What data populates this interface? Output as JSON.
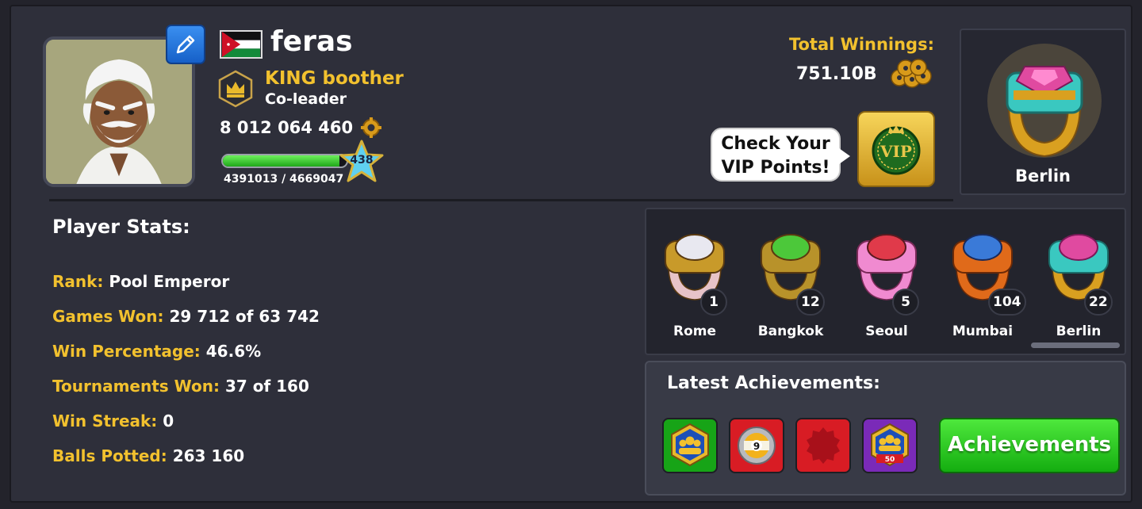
{
  "profile": {
    "name": "feras",
    "club_name": "KING boother",
    "club_role": "Co-leader",
    "coins": "8 012 064 460",
    "xp_text": "4391013 / 4669047",
    "xp_fraction": 0.94,
    "level": "438"
  },
  "winnings": {
    "label": "Total Winnings:",
    "value": "751.10B"
  },
  "vip": {
    "bubble_text": "Check Your VIP Points!",
    "badge_text": "VIP"
  },
  "league": {
    "name": "Berlin"
  },
  "stats": {
    "title": "Player Stats:",
    "rows": [
      {
        "label": "Rank:",
        "value": "Pool Emperor"
      },
      {
        "label": "Games Won:",
        "value": "29 712 of 63 742"
      },
      {
        "label": "Win Percentage:",
        "value": "46.6%"
      },
      {
        "label": "Tournaments Won:",
        "value": "37 of 160"
      },
      {
        "label": "Win Streak:",
        "value": "0"
      },
      {
        "label": "Balls Potted:",
        "value": "263 160"
      }
    ]
  },
  "rings": [
    {
      "name": "Rome",
      "count": "1",
      "stone": "#e8e8f0",
      "band": "#e7c3c8"
    },
    {
      "name": "Bangkok",
      "count": "12",
      "stone": "#4cc83a",
      "band": "#b8922a"
    },
    {
      "name": "Seoul",
      "count": "5",
      "stone": "#e03a4a",
      "band": "#f08ad0"
    },
    {
      "name": "Mumbai",
      "count": "104",
      "stone": "#3a7ad8",
      "band": "#e06a1a"
    },
    {
      "name": "Berlin",
      "count": "22",
      "stone": "#e04aa0",
      "band": "#3ac8c0"
    }
  ],
  "achievements": {
    "title": "Latest Achievements:",
    "button_label": "Achievements",
    "icons": [
      {
        "name": "club-achievement-icon",
        "color": "#17a417"
      },
      {
        "name": "nine-ball-achievement-icon",
        "color": "#d81c24"
      },
      {
        "name": "red-seal-achievement-icon",
        "color": "#d81c24"
      },
      {
        "name": "club-50-achievement-icon",
        "color": "#7a2ab8"
      }
    ],
    "badge_50": "50",
    "nine_ball": "9"
  }
}
